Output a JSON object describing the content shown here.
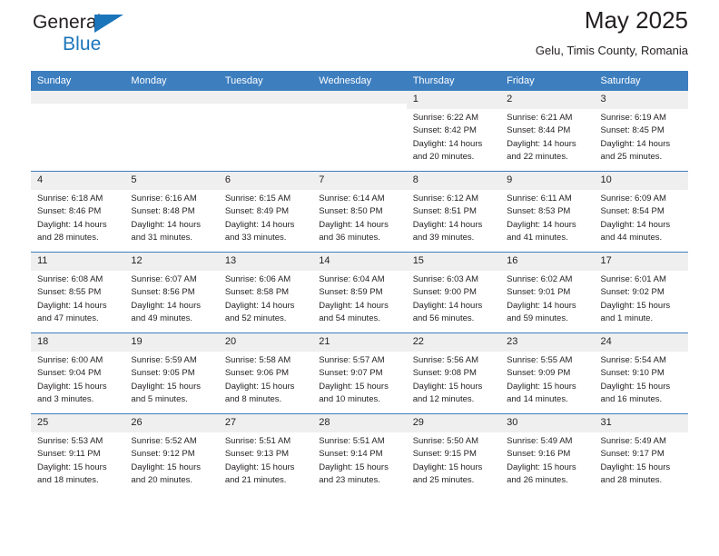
{
  "brand": {
    "name_line1": "General",
    "name_line2": "Blue",
    "accent_color": "#1b75bb"
  },
  "header": {
    "title": "May 2025",
    "subtitle": "Gelu, Timis County, Romania",
    "header_bg_color": "#3d7ebf",
    "daynum_band_color": "#efefef"
  },
  "labels": {
    "sunrise_prefix": "Sunrise:",
    "sunset_prefix": "Sunset:",
    "daylight_prefix": "Daylight:"
  },
  "calendar": {
    "weekday_headers": [
      "Sunday",
      "Monday",
      "Tuesday",
      "Wednesday",
      "Thursday",
      "Friday",
      "Saturday"
    ],
    "weeks": [
      [
        {
          "day": "",
          "empty": true
        },
        {
          "day": "",
          "empty": true
        },
        {
          "day": "",
          "empty": true
        },
        {
          "day": "",
          "empty": true
        },
        {
          "day": "1",
          "sunrise": "Sunrise: 6:22 AM",
          "sunset": "Sunset: 8:42 PM",
          "daylight": "Daylight: 14 hours and 20 minutes."
        },
        {
          "day": "2",
          "sunrise": "Sunrise: 6:21 AM",
          "sunset": "Sunset: 8:44 PM",
          "daylight": "Daylight: 14 hours and 22 minutes."
        },
        {
          "day": "3",
          "sunrise": "Sunrise: 6:19 AM",
          "sunset": "Sunset: 8:45 PM",
          "daylight": "Daylight: 14 hours and 25 minutes."
        }
      ],
      [
        {
          "day": "4",
          "sunrise": "Sunrise: 6:18 AM",
          "sunset": "Sunset: 8:46 PM",
          "daylight": "Daylight: 14 hours and 28 minutes."
        },
        {
          "day": "5",
          "sunrise": "Sunrise: 6:16 AM",
          "sunset": "Sunset: 8:48 PM",
          "daylight": "Daylight: 14 hours and 31 minutes."
        },
        {
          "day": "6",
          "sunrise": "Sunrise: 6:15 AM",
          "sunset": "Sunset: 8:49 PM",
          "daylight": "Daylight: 14 hours and 33 minutes."
        },
        {
          "day": "7",
          "sunrise": "Sunrise: 6:14 AM",
          "sunset": "Sunset: 8:50 PM",
          "daylight": "Daylight: 14 hours and 36 minutes."
        },
        {
          "day": "8",
          "sunrise": "Sunrise: 6:12 AM",
          "sunset": "Sunset: 8:51 PM",
          "daylight": "Daylight: 14 hours and 39 minutes."
        },
        {
          "day": "9",
          "sunrise": "Sunrise: 6:11 AM",
          "sunset": "Sunset: 8:53 PM",
          "daylight": "Daylight: 14 hours and 41 minutes."
        },
        {
          "day": "10",
          "sunrise": "Sunrise: 6:09 AM",
          "sunset": "Sunset: 8:54 PM",
          "daylight": "Daylight: 14 hours and 44 minutes."
        }
      ],
      [
        {
          "day": "11",
          "sunrise": "Sunrise: 6:08 AM",
          "sunset": "Sunset: 8:55 PM",
          "daylight": "Daylight: 14 hours and 47 minutes."
        },
        {
          "day": "12",
          "sunrise": "Sunrise: 6:07 AM",
          "sunset": "Sunset: 8:56 PM",
          "daylight": "Daylight: 14 hours and 49 minutes."
        },
        {
          "day": "13",
          "sunrise": "Sunrise: 6:06 AM",
          "sunset": "Sunset: 8:58 PM",
          "daylight": "Daylight: 14 hours and 52 minutes."
        },
        {
          "day": "14",
          "sunrise": "Sunrise: 6:04 AM",
          "sunset": "Sunset: 8:59 PM",
          "daylight": "Daylight: 14 hours and 54 minutes."
        },
        {
          "day": "15",
          "sunrise": "Sunrise: 6:03 AM",
          "sunset": "Sunset: 9:00 PM",
          "daylight": "Daylight: 14 hours and 56 minutes."
        },
        {
          "day": "16",
          "sunrise": "Sunrise: 6:02 AM",
          "sunset": "Sunset: 9:01 PM",
          "daylight": "Daylight: 14 hours and 59 minutes."
        },
        {
          "day": "17",
          "sunrise": "Sunrise: 6:01 AM",
          "sunset": "Sunset: 9:02 PM",
          "daylight": "Daylight: 15 hours and 1 minute."
        }
      ],
      [
        {
          "day": "18",
          "sunrise": "Sunrise: 6:00 AM",
          "sunset": "Sunset: 9:04 PM",
          "daylight": "Daylight: 15 hours and 3 minutes."
        },
        {
          "day": "19",
          "sunrise": "Sunrise: 5:59 AM",
          "sunset": "Sunset: 9:05 PM",
          "daylight": "Daylight: 15 hours and 5 minutes."
        },
        {
          "day": "20",
          "sunrise": "Sunrise: 5:58 AM",
          "sunset": "Sunset: 9:06 PM",
          "daylight": "Daylight: 15 hours and 8 minutes."
        },
        {
          "day": "21",
          "sunrise": "Sunrise: 5:57 AM",
          "sunset": "Sunset: 9:07 PM",
          "daylight": "Daylight: 15 hours and 10 minutes."
        },
        {
          "day": "22",
          "sunrise": "Sunrise: 5:56 AM",
          "sunset": "Sunset: 9:08 PM",
          "daylight": "Daylight: 15 hours and 12 minutes."
        },
        {
          "day": "23",
          "sunrise": "Sunrise: 5:55 AM",
          "sunset": "Sunset: 9:09 PM",
          "daylight": "Daylight: 15 hours and 14 minutes."
        },
        {
          "day": "24",
          "sunrise": "Sunrise: 5:54 AM",
          "sunset": "Sunset: 9:10 PM",
          "daylight": "Daylight: 15 hours and 16 minutes."
        }
      ],
      [
        {
          "day": "25",
          "sunrise": "Sunrise: 5:53 AM",
          "sunset": "Sunset: 9:11 PM",
          "daylight": "Daylight: 15 hours and 18 minutes."
        },
        {
          "day": "26",
          "sunrise": "Sunrise: 5:52 AM",
          "sunset": "Sunset: 9:12 PM",
          "daylight": "Daylight: 15 hours and 20 minutes."
        },
        {
          "day": "27",
          "sunrise": "Sunrise: 5:51 AM",
          "sunset": "Sunset: 9:13 PM",
          "daylight": "Daylight: 15 hours and 21 minutes."
        },
        {
          "day": "28",
          "sunrise": "Sunrise: 5:51 AM",
          "sunset": "Sunset: 9:14 PM",
          "daylight": "Daylight: 15 hours and 23 minutes."
        },
        {
          "day": "29",
          "sunrise": "Sunrise: 5:50 AM",
          "sunset": "Sunset: 9:15 PM",
          "daylight": "Daylight: 15 hours and 25 minutes."
        },
        {
          "day": "30",
          "sunrise": "Sunrise: 5:49 AM",
          "sunset": "Sunset: 9:16 PM",
          "daylight": "Daylight: 15 hours and 26 minutes."
        },
        {
          "day": "31",
          "sunrise": "Sunrise: 5:49 AM",
          "sunset": "Sunset: 9:17 PM",
          "daylight": "Daylight: 15 hours and 28 minutes."
        }
      ]
    ]
  }
}
